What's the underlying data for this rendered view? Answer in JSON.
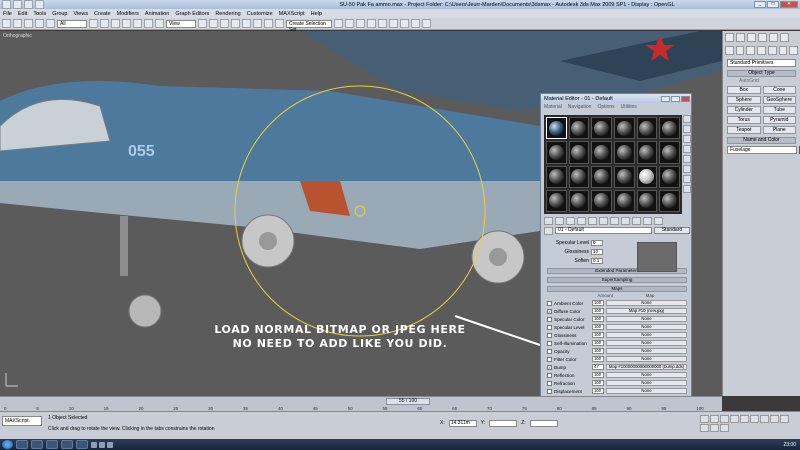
{
  "window": {
    "title": "SU-50 Pak Fa ammo.max  - Project Folder: C:\\Users\\Jeurr-Marden\\Documents\\3dsmax  - Autodesk 3ds Max  2009 SP1  - Display : OpenGL"
  },
  "menu": [
    "File",
    "Edit",
    "Tools",
    "Group",
    "Views",
    "Create",
    "Modifiers",
    "Animation",
    "Graph Editors",
    "Rendering",
    "Customize",
    "MAXScript",
    "Help"
  ],
  "toolbar": {
    "filter_select": "All",
    "view_select": "View",
    "selection_set": "Create Selection Set"
  },
  "viewport": {
    "label": "Orthographic",
    "annotation_line1": "LOAD NORMAL BITMAP OR JPEG HERE",
    "annotation_line2": "NO NEED TO ADD LIKE YOU DID.",
    "jet_number": "055"
  },
  "command_panel": {
    "category": "Standard Primitives",
    "object_type_header": "Object Type",
    "autogrid_label": "AutoGrid",
    "buttons": [
      "Box",
      "Cone",
      "Sphere",
      "GeoSphere",
      "Cylinder",
      "Tube",
      "Torus",
      "Pyramid",
      "Teapot",
      "Plane"
    ],
    "name_color_header": "Name and Color",
    "object_name": "Fuselage"
  },
  "material_editor": {
    "title": "Material Editor - 01 - Default",
    "menu": [
      "Material",
      "Navigation",
      "Options",
      "Utilities"
    ],
    "material_name": "01 - Default",
    "material_type": "Standard",
    "params": [
      {
        "label": "Specular Level",
        "value": "0"
      },
      {
        "label": "Glossiness",
        "value": "10"
      },
      {
        "label": "Soften",
        "value": "0.1"
      }
    ],
    "rollouts": {
      "extended": "Extended Parameters",
      "supersampling": "SuperSampling",
      "maps": "Maps"
    },
    "maps_header": {
      "amount": "Amount",
      "map": "Map"
    },
    "maps": [
      {
        "checked": false,
        "label": "Ambient Color",
        "amount": "100",
        "map": "None"
      },
      {
        "checked": true,
        "label": "Diffuse Color",
        "amount": "100",
        "map": "Map #10 (new.jpg)"
      },
      {
        "checked": false,
        "label": "Specular Color",
        "amount": "100",
        "map": "None"
      },
      {
        "checked": false,
        "label": "Specular Level",
        "amount": "100",
        "map": "None"
      },
      {
        "checked": false,
        "label": "Glossiness",
        "amount": "100",
        "map": "None"
      },
      {
        "checked": false,
        "label": "Self-Illumination",
        "amount": "100",
        "map": "None"
      },
      {
        "checked": false,
        "label": "Opacity",
        "amount": "100",
        "map": "None"
      },
      {
        "checked": false,
        "label": "Filter Color",
        "amount": "100",
        "map": "None"
      },
      {
        "checked": true,
        "label": "Bump",
        "amount": "47",
        "map": "Map #10000000000000000 (bump.dds)"
      },
      {
        "checked": false,
        "label": "Reflection",
        "amount": "100",
        "map": "None"
      },
      {
        "checked": false,
        "label": "Refraction",
        "amount": "100",
        "map": "None"
      },
      {
        "checked": false,
        "label": "Displacement",
        "amount": "100",
        "map": "None"
      },
      {
        "checked": false,
        "label": "",
        "amount": "100",
        "map": "None"
      },
      {
        "checked": false,
        "label": "",
        "amount": "100",
        "map": "None"
      }
    ]
  },
  "timeline": {
    "frame": "55 / 100",
    "ticks": [
      "0",
      "5",
      "10",
      "15",
      "20",
      "25",
      "30",
      "35",
      "40",
      "45",
      "50",
      "55",
      "60",
      "65",
      "70",
      "75",
      "80",
      "85",
      "90",
      "95",
      "100"
    ]
  },
  "statusbar": {
    "script_listener": "MAXScript.",
    "selected": "1 Object Selected",
    "prompt": "Click and drag to rotate the view.  Clicking in the tabs constrains the rotation",
    "x": "X:",
    "y": "Y:",
    "z": "Z:",
    "x_value": "14.311m",
    "y_value": "",
    "z_value": ""
  },
  "taskbar": {
    "time": "23:00"
  },
  "colors": {
    "viewport_bg": "#5b5b5b",
    "jet_blue": "#3f6f92",
    "gizmo_yellow": "#e6d23a",
    "panel_bg": "#c9ced6"
  }
}
